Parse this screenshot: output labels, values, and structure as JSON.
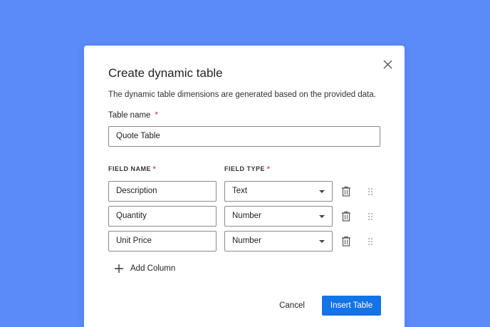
{
  "dialog": {
    "title": "Create dynamic table",
    "description": "The dynamic table dimensions are generated based on the provided data.",
    "close_icon": "close-icon"
  },
  "table_name": {
    "label": "Table name",
    "required_mark": "*",
    "value": "Quote Table"
  },
  "columns_header": {
    "field_name": "FIELD NAME",
    "field_type": "FIELD TYPE",
    "required_mark": "*"
  },
  "rows": [
    {
      "name": "Description",
      "type": "Text"
    },
    {
      "name": "Quantity",
      "type": "Number"
    },
    {
      "name": "Unit Price",
      "type": "Number"
    }
  ],
  "icons": {
    "delete": "trash-icon",
    "drag": "drag-handle-icon",
    "add": "plus-icon"
  },
  "add_column_label": "Add Column",
  "actions": {
    "cancel": "Cancel",
    "insert": "Insert Table"
  },
  "colors": {
    "background": "#5b8bf9",
    "primary": "#1473e6",
    "required": "#d9242b"
  }
}
